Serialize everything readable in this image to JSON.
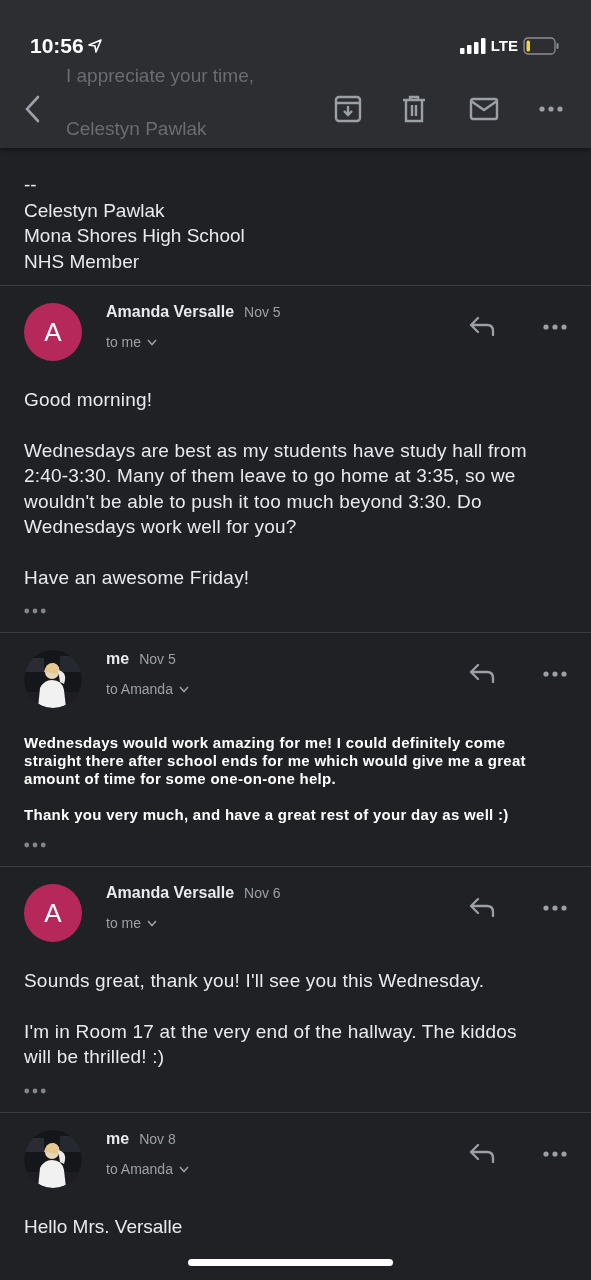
{
  "status_bar": {
    "time": "10:56",
    "network": "LTE"
  },
  "scrolled_under": [
    "I appreciate your time,",
    "Celestyn Pawlak"
  ],
  "signature": [
    "--",
    "Celestyn Pawlak",
    "Mona Shores High School",
    "NHS Member"
  ],
  "messages": [
    {
      "kind": "received",
      "sender": "Amanda Versalle",
      "date": "Nov 5",
      "recipient": "to me",
      "avatar": {
        "kind": "letter",
        "letter": "A",
        "color": "#b7285a"
      },
      "paragraphs": [
        "Good morning!",
        "Wednesdays are best as my students have study hall from 2:40-3:30. Many of them leave to go home at 3:35, so we wouldn't be able to push it too much beyond 3:30. Do Wednesdays work well for you?",
        "Have an awesome Friday!"
      ],
      "trimmed": true
    },
    {
      "kind": "sent",
      "sender": "me",
      "date": "Nov 5",
      "recipient": "to Amanda",
      "avatar": {
        "kind": "picture"
      },
      "paragraphs": [
        "Wednesdays would work amazing for me! I could definitely come straight there after school ends for me which would give me a great amount of time for some one-on-one help.",
        "Thank you very much, and have a great rest of your day as well :)"
      ],
      "trimmed": true
    },
    {
      "kind": "received",
      "sender": "Amanda Versalle",
      "date": "Nov 6",
      "recipient": "to me",
      "avatar": {
        "kind": "letter",
        "letter": "A",
        "color": "#b7285a"
      },
      "paragraphs": [
        "Sounds great, thank you! I'll see you this Wednesday.",
        "I'm in Room 17 at the very end of the hallway. The kiddos will be thrilled! :)"
      ],
      "trimmed": true
    },
    {
      "kind": "partial",
      "sender": "me",
      "date": "Nov 8",
      "recipient": "to Amanda",
      "avatar": {
        "kind": "picture"
      },
      "paragraphs": [
        "Hello Mrs. Versalle"
      ],
      "trimmed": false
    }
  ]
}
